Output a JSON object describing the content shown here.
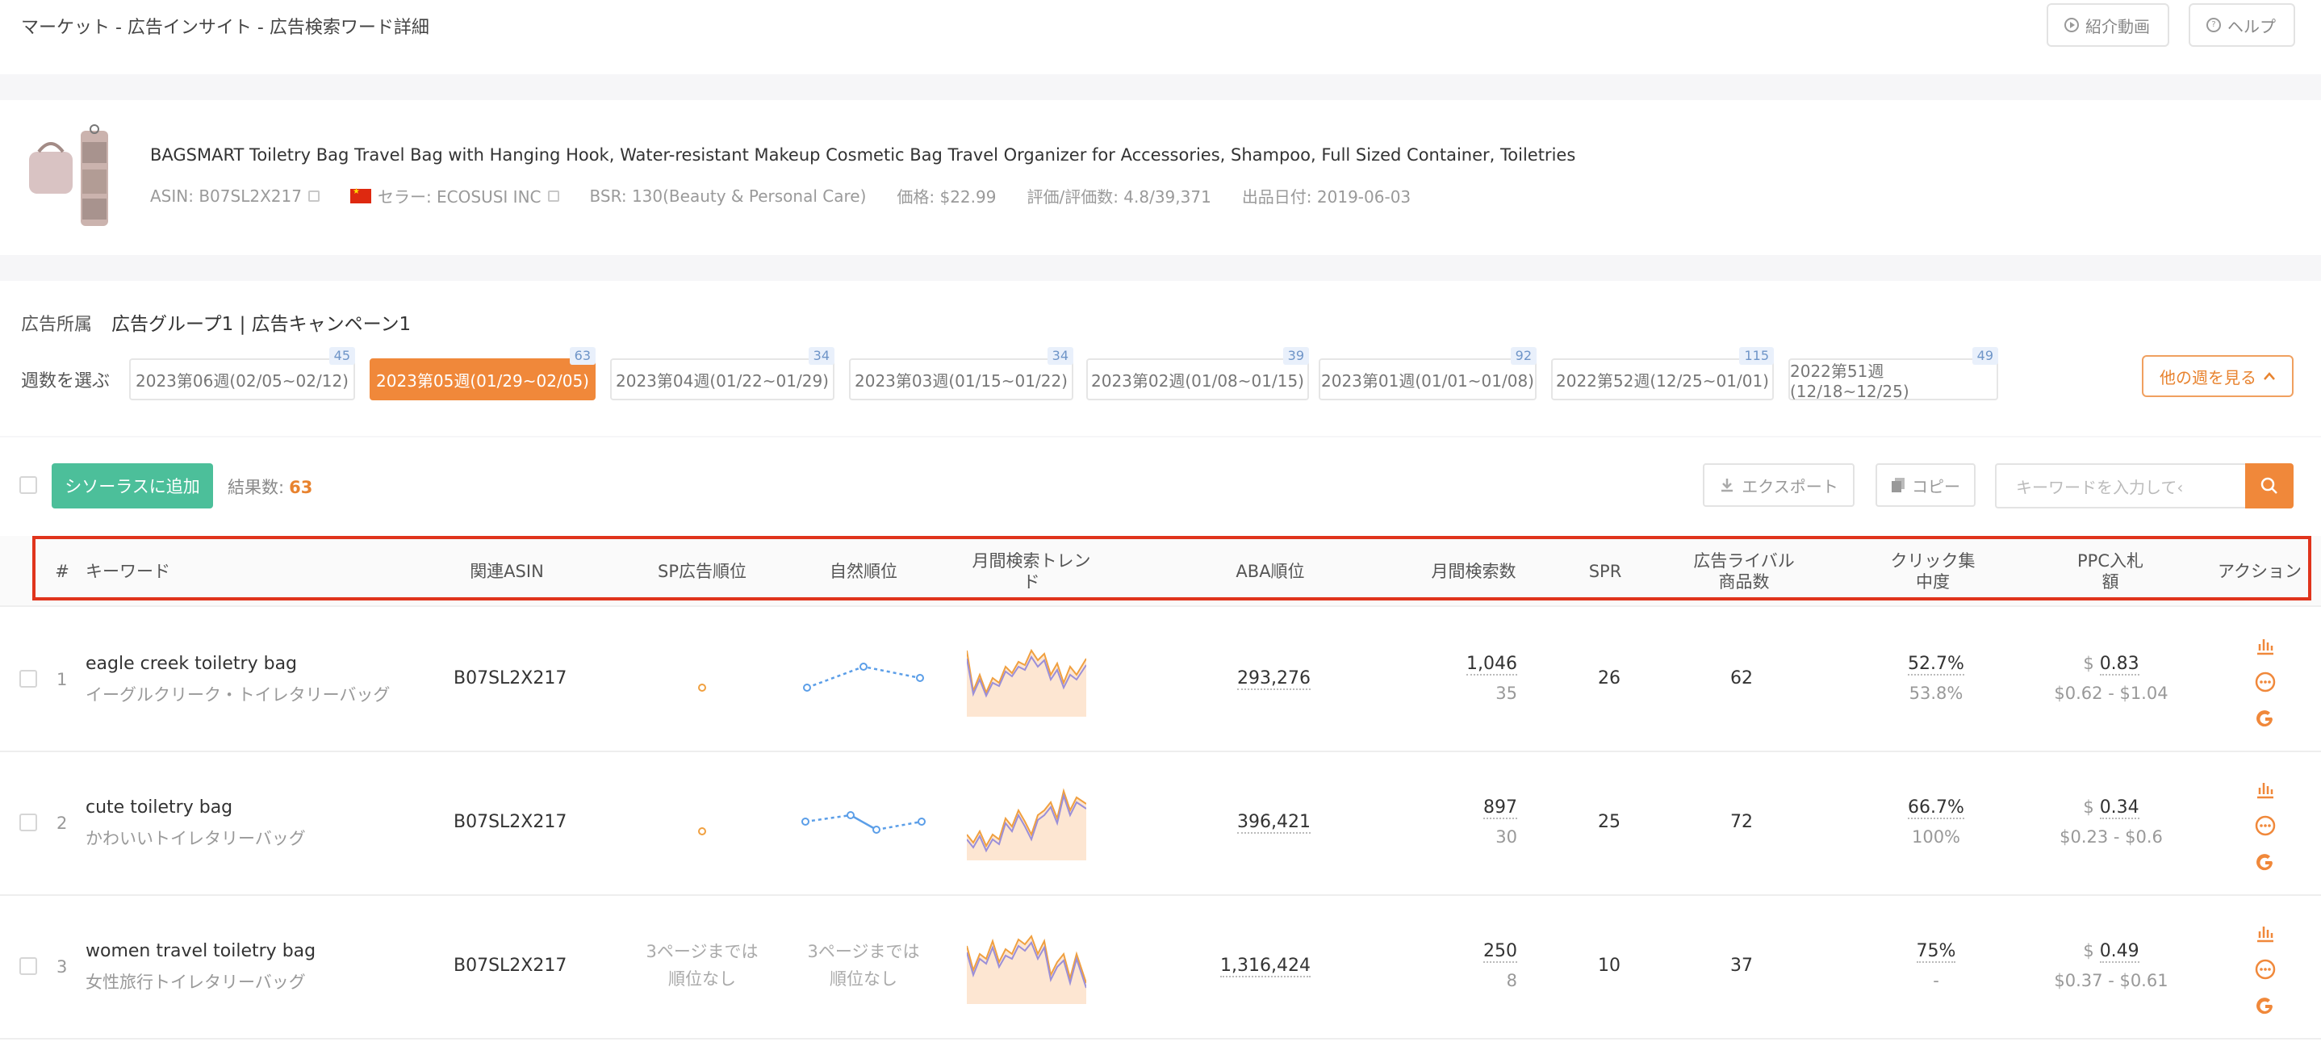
{
  "header": {
    "breadcrumb": "マーケット - 広告インサイト - 広告検索ワード詳細",
    "video_button": "紹介動画",
    "help_button": "ヘルプ"
  },
  "product": {
    "title": "BAGSMART Toiletry Bag Travel Bag with Hanging Hook, Water-resistant Makeup Cosmetic Bag Travel Organizer for Accessories, Shampoo, Full Sized Container, Toiletries",
    "asin": "ASIN: B07SL2X217",
    "seller": "セラー: ECOSUSI INC",
    "bsr": "BSR: 130(Beauty & Personal Care)",
    "price": "価格: $22.99",
    "rating": "評価/評価数: 4.8/39,371",
    "listed": "出品日付: 2019-06-03"
  },
  "filter": {
    "ad_label": "広告所属",
    "ad_value": "広告グループ1 | 広告キャンペーン1",
    "week_label": "週数を選ぶ",
    "weeks": [
      {
        "label": "2023第06週(02/05~02/12)",
        "count": "45"
      },
      {
        "label": "2023第05週(01/29~02/05)",
        "count": "63"
      },
      {
        "label": "2023第04週(01/22~01/29)",
        "count": "34"
      },
      {
        "label": "2023第03週(01/15~01/22)",
        "count": "34"
      },
      {
        "label": "2023第02週(01/08~01/15)",
        "count": "39"
      },
      {
        "label": "2023第01週(01/01~01/08)",
        "count": "92"
      },
      {
        "label": "2022第52週(12/25~01/01)",
        "count": "115"
      },
      {
        "label": "2022第51週(12/18~12/25)",
        "count": "49"
      }
    ],
    "active_week": 1,
    "more_weeks": "他の週を見る"
  },
  "toolbar": {
    "add_button": "シソーラスに追加",
    "result_label": "結果数:",
    "result_count": "63",
    "export": "エクスポート",
    "copy": "コピー",
    "search_placeholder": "キーワードを入力して‹"
  },
  "columns": {
    "index": "#",
    "keyword": "キーワード",
    "asin": "関連ASIN",
    "sp_rank": "SP広告順位",
    "organic_rank": "自然順位",
    "trend": "月間検索トレンド",
    "aba": "ABA順位",
    "monthly": "月間検索数",
    "spr": "SPR",
    "rivals": "広告ライバル商品数",
    "click": "クリック集中度",
    "ppc": "PPC入札額",
    "action": "アクション"
  },
  "rows": [
    {
      "index": "1",
      "keyword": "eagle creek toiletry bag",
      "keyword_ja": "イーグルクリーク・トイレタリーバッグ",
      "asin": "B07SL2X217",
      "sp_rank": "",
      "organic_rank": "",
      "aba": "293,276",
      "monthly": "1,046",
      "monthly_sub": "35",
      "spr": "26",
      "rivals": "62",
      "click": "52.7%",
      "click_sub": "53.8%",
      "ppc_symbol": "$",
      "ppc": "0.83",
      "ppc_range": "$0.62 - $1.04"
    },
    {
      "index": "2",
      "keyword": "cute toiletry bag",
      "keyword_ja": "かわいいトイレタリーバッグ",
      "asin": "B07SL2X217",
      "sp_rank": "",
      "organic_rank": "",
      "aba": "396,421",
      "monthly": "897",
      "monthly_sub": "30",
      "spr": "25",
      "rivals": "72",
      "click": "66.7%",
      "click_sub": "100%",
      "ppc_symbol": "$",
      "ppc": "0.34",
      "ppc_range": "$0.23 - $0.6"
    },
    {
      "index": "3",
      "keyword": "women travel toiletry bag",
      "keyword_ja": "女性旅行トイレタリーバッグ",
      "asin": "B07SL2X217",
      "sp_rank": "3ページまでは順位なし",
      "organic_rank": "3ページまでは順位なし",
      "aba": "1,316,424",
      "monthly": "250",
      "monthly_sub": "8",
      "spr": "10",
      "rivals": "37",
      "click": "75%",
      "click_sub": "-",
      "ppc_symbol": "$",
      "ppc": "0.49",
      "ppc_range": "$0.37 - $0.61"
    }
  ],
  "colors": {
    "accent": "#f0883a",
    "green": "#4cbf9a",
    "highlight": "#e0341c",
    "sparkline": "#5b9ee8"
  }
}
